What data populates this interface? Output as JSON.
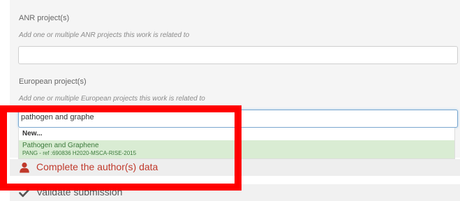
{
  "form": {
    "anr": {
      "label": "ANR project(s)",
      "hint": "Add one or multiple ANR projects this work is related to",
      "value": ""
    },
    "european": {
      "label": "European project(s)",
      "hint": "Add one or multiple European projects this work is related to",
      "value": "pathogen and graphe"
    }
  },
  "autocomplete": {
    "new_label": "New...",
    "items": [
      {
        "title": "Pathogen and Graphene",
        "detail": "PANG - ref :690836 H2020-MSCA-RISE-2015"
      }
    ]
  },
  "steps": {
    "author": {
      "label": "Complete the author(s) data",
      "icon": "user-icon"
    },
    "validate": {
      "label": "Validate submission",
      "icon": "check-icon"
    }
  },
  "colors": {
    "highlight_frame": "#ff0000",
    "author_step_text": "#c0392b",
    "suggestion_bg": "#d9ecd3",
    "suggestion_text": "#3a7a3a",
    "input_focus_border": "#7aa7cf"
  }
}
